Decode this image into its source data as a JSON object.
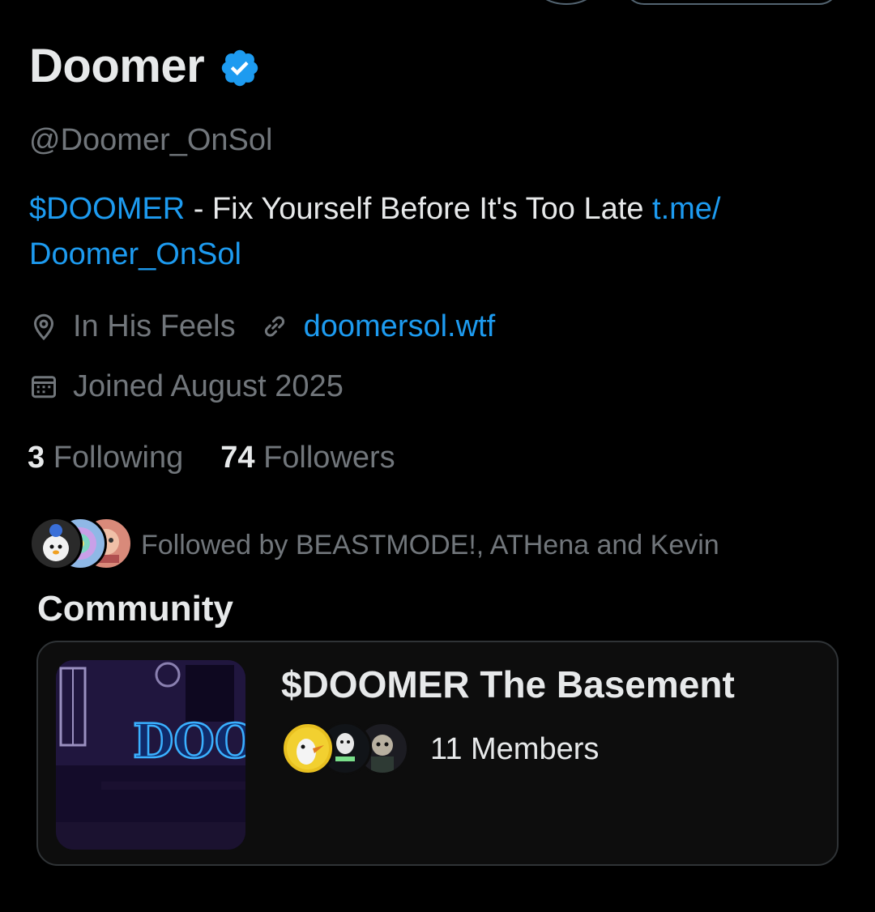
{
  "profile": {
    "display_name": "Doomer",
    "handle": "@Doomer_OnSol",
    "verified_icon": "verified-badge-icon"
  },
  "bio": {
    "ticker": "$DOOMER",
    "text": " - Fix Yourself Before It's Too Late ",
    "link_part1": "t.me/",
    "link_part2": "Doomer_OnSol"
  },
  "meta": {
    "location": "In His Feels",
    "website": "doomersol.wtf",
    "joined": "Joined August 2025"
  },
  "stats": {
    "following_count": "3",
    "following_label": "Following",
    "followers_count": "74",
    "followers_label": "Followers"
  },
  "followed_by": {
    "text": "Followed by BEASTMODE!, ATHena and Kevin"
  },
  "community": {
    "heading": "Community",
    "title": "$DOOMER The Basement",
    "members": "11 Members",
    "thumb_text": "DOO"
  },
  "colors": {
    "background": "#000000",
    "text_primary": "#e7e9ea",
    "text_secondary": "#71767b",
    "link": "#1d9bf0",
    "verified": "#1d9bf0",
    "card_bg": "#0d0d0d",
    "card_border": "#2f3336"
  }
}
